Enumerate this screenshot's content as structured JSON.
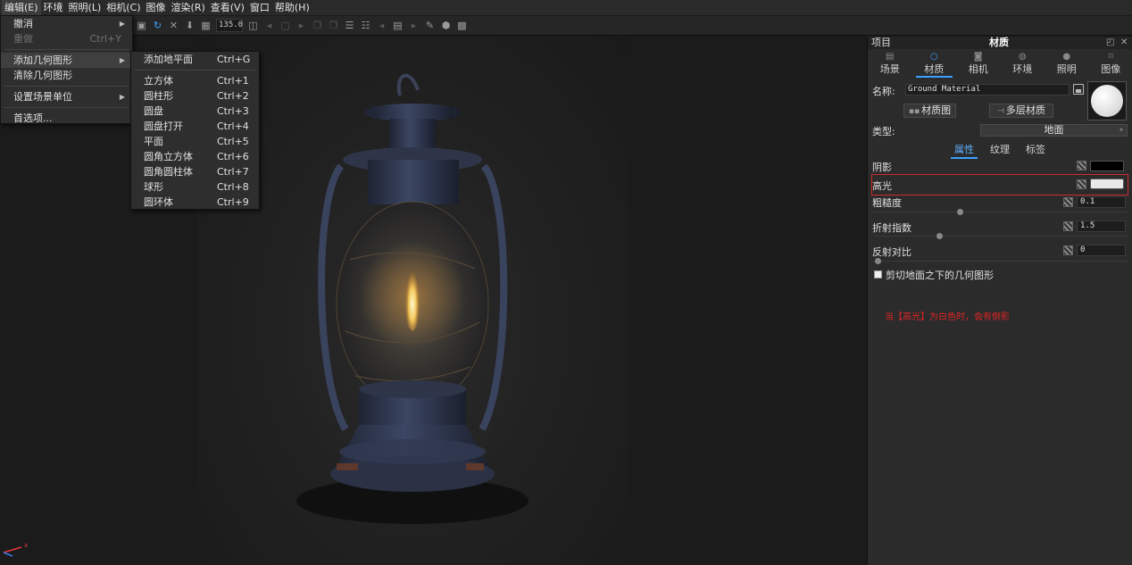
{
  "menubar": {
    "items": [
      "编辑(E)",
      "环境",
      "照明(L)",
      "相机(C)",
      "图像",
      "渲染(R)",
      "查看(V)",
      "窗口",
      "帮助(H)"
    ]
  },
  "edit_menu": {
    "undo": "撤消",
    "redo": "重做",
    "redo_shortcut": "Ctrl+Y",
    "add_geometry": "添加几何图形",
    "clear_geometry": "清除几何图形",
    "scene_units": "设置场景单位",
    "preferences": "首选项..."
  },
  "geometry_menu": {
    "items": [
      {
        "label": "添加地平面",
        "shortcut": "Ctrl+G"
      },
      {
        "label": "立方体",
        "shortcut": "Ctrl+1"
      },
      {
        "label": "圆柱形",
        "shortcut": "Ctrl+2"
      },
      {
        "label": "圆盘",
        "shortcut": "Ctrl+3"
      },
      {
        "label": "圆盘打开",
        "shortcut": "Ctrl+4"
      },
      {
        "label": "平面",
        "shortcut": "Ctrl+5"
      },
      {
        "label": "圆角立方体",
        "shortcut": "Ctrl+6"
      },
      {
        "label": "圆角圆柱体",
        "shortcut": "Ctrl+7"
      },
      {
        "label": "球形",
        "shortcut": "Ctrl+8"
      },
      {
        "label": "圆环体",
        "shortcut": "Ctrl+9"
      }
    ]
  },
  "toolbar": {
    "zoom_value": "135.0"
  },
  "panel": {
    "project_label": "项目",
    "title": "材质",
    "tabs": [
      "场景",
      "材质",
      "相机",
      "环境",
      "照明",
      "图像"
    ],
    "name_label": "名称:",
    "name_value": "Ground Material",
    "material_graph_button": "材质图",
    "multilayer_button": "多层材质",
    "type_label": "类型:",
    "type_value": "地面",
    "subtabs": [
      "属性",
      "纹理",
      "标签"
    ],
    "props": {
      "shadow": "阴影",
      "highlight": "高光",
      "roughness": "粗糙度",
      "roughness_value": "0.1",
      "ior": "折射指数",
      "ior_value": "1.5",
      "reflect_contrast": "反射对比",
      "reflect_contrast_value": "0"
    },
    "clip_checkbox": "剪切地面之下的几何图形",
    "note": "当【高光】为白色时，会有倒影"
  },
  "colors": {
    "accent": "#3aa0ff",
    "shadow_swatch": "#000000",
    "highlight_swatch": "#e8e8e8",
    "annotation_red": "#e02424"
  }
}
